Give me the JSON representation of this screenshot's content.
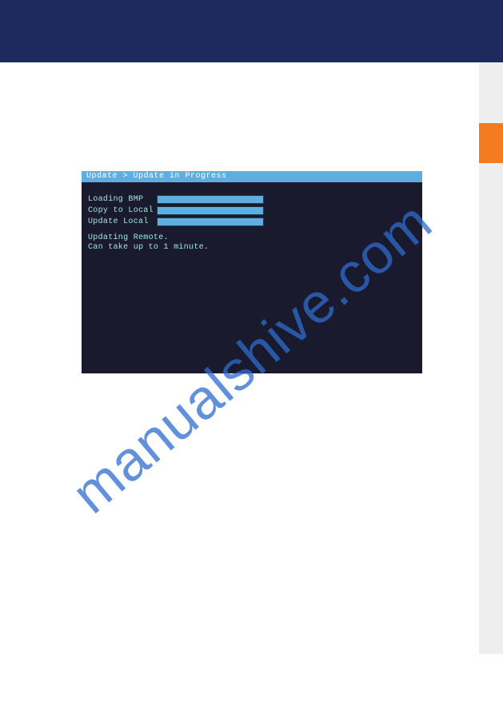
{
  "watermark": "manualshive.com",
  "screen": {
    "breadcrumb": "Update > Update in Progress",
    "rows": [
      {
        "label": "Loading BMP",
        "progress": 100
      },
      {
        "label": "Copy to Local",
        "progress": 100
      },
      {
        "label": "Update Local",
        "progress": 100
      }
    ],
    "status_line1": "Updating Remote.",
    "status_line2": "Can take up to 1 minute."
  }
}
